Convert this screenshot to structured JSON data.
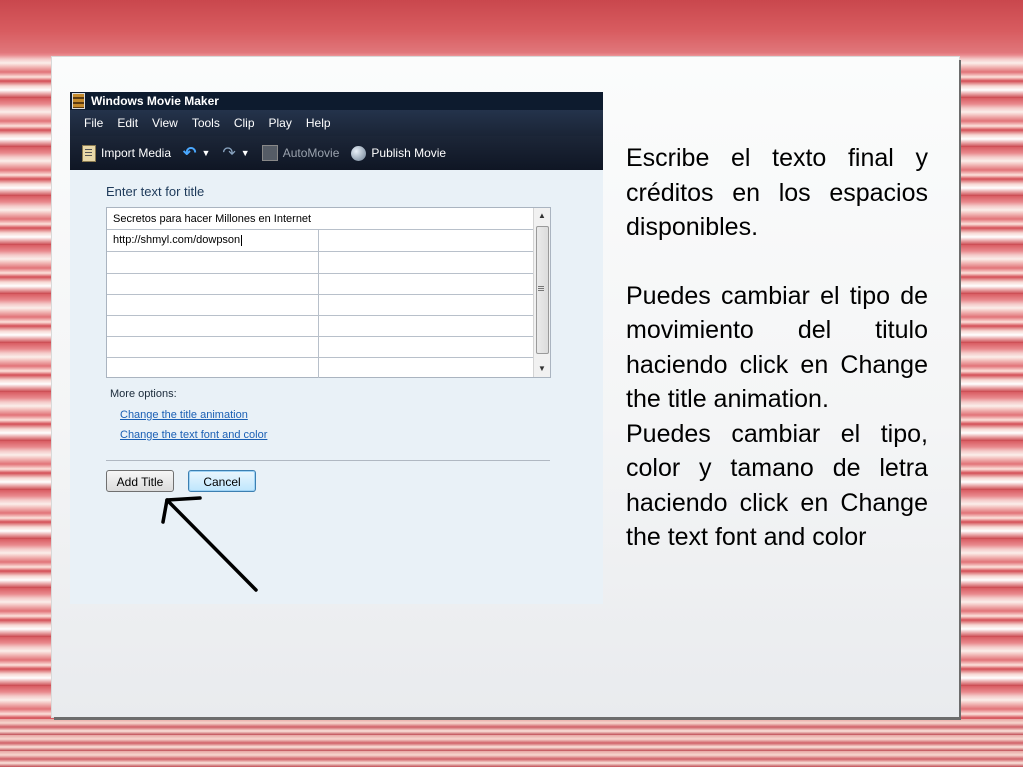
{
  "window": {
    "title": "Windows Movie Maker"
  },
  "menu": [
    "File",
    "Edit",
    "View",
    "Tools",
    "Clip",
    "Play",
    "Help"
  ],
  "toolbar": {
    "import_media": "Import Media",
    "automovie": "AutoMovie",
    "publish_movie": "Publish Movie"
  },
  "title_editor": {
    "heading": "Enter text for title",
    "line1": "Secretos para hacer Millones en Internet",
    "line2": "http://shmyl.com/dowpson",
    "more_options": "More options:",
    "link_animation": "Change the title animation",
    "link_font": "Change the text font and color",
    "add_title": "Add Title",
    "cancel": "Cancel"
  },
  "description": {
    "para1": "Escribe el texto final y créditos en los espacios disponibles.",
    "para2": "Puedes cambiar el tipo de movimiento del titulo haciendo click en Change the title animation.",
    "para3": "Puedes cambiar el tipo, color y  tamano de letra haciendo click en Change the text font and color"
  }
}
